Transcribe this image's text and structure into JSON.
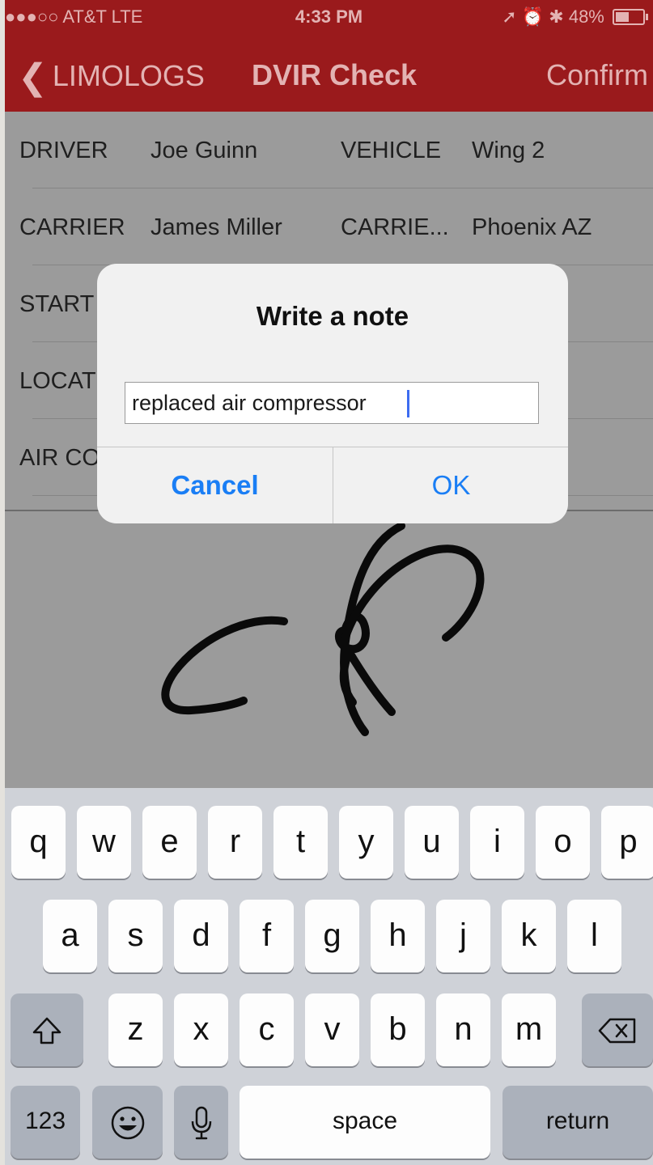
{
  "status_bar": {
    "carrier": "●●●○○ AT&T  LTE",
    "time": "4:33 PM",
    "indicators": "➚ ⏰ ✱ 48%"
  },
  "nav": {
    "back_label": "LIMOLOGS",
    "title": "DVIR Check",
    "confirm_label": "Confirm"
  },
  "form": {
    "rows": [
      {
        "label1": "DRIVER",
        "value1": "Joe Guinn",
        "label2": "VEHICLE",
        "value2": "Wing 2"
      },
      {
        "label1": "CARRIER",
        "value1": "James Miller",
        "label2": "CARRIE...",
        "value2": "Phoenix AZ"
      },
      {
        "label1": "START"
      },
      {
        "label1": "LOCAT"
      },
      {
        "label1": "AIR CO"
      }
    ]
  },
  "dialog": {
    "title": "Write a note",
    "input_value": "replaced air compressor",
    "cancel_label": "Cancel",
    "ok_label": "OK"
  },
  "keyboard": {
    "row1": [
      "q",
      "w",
      "e",
      "r",
      "t",
      "y",
      "u",
      "i",
      "o",
      "p"
    ],
    "row2": [
      "a",
      "s",
      "d",
      "f",
      "g",
      "h",
      "j",
      "k",
      "l"
    ],
    "row3": [
      "z",
      "x",
      "c",
      "v",
      "b",
      "n",
      "m"
    ],
    "numbers_label": "123",
    "space_label": "space",
    "return_label": "return"
  },
  "colors": {
    "nav_bar": "#9a1a1c",
    "accent": "#1a7ef5",
    "caret": "#3d6cf0"
  }
}
